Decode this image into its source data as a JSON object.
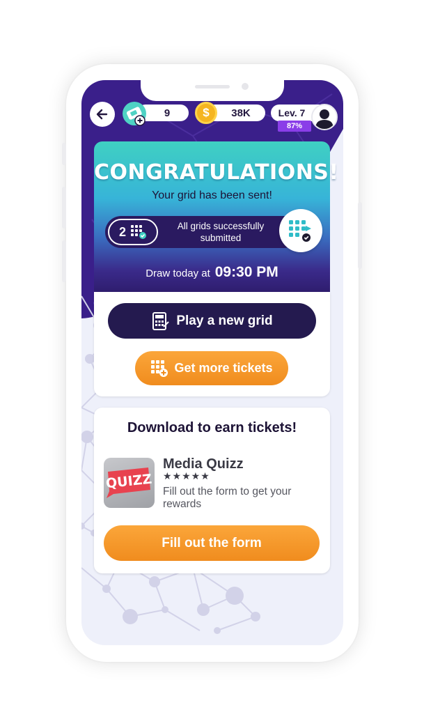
{
  "top_bar": {
    "tickets_count": "9",
    "coins": "38K",
    "level": "Lev. 7",
    "level_progress": "87%",
    "level_progress_fraction": 0.87
  },
  "congrats_card": {
    "title": "CONGRATULATIONS!",
    "subtitle": "Your grid has been sent!",
    "grid_count": "2",
    "status_text": "All grids successfully submitted",
    "draw_label": "Draw today at",
    "draw_time": "09:30 PM",
    "play_button": "Play a new grid",
    "tickets_button": "Get more tickets"
  },
  "download_card": {
    "title": "Download to earn tickets!",
    "app": {
      "icon_text": "QUIZZ",
      "name": "Media Quizz",
      "stars": "★★★★★",
      "description": "Fill out the form to get your rewards"
    },
    "form_button": "Fill out the form"
  },
  "colors": {
    "header_purple": "#3a1f8a",
    "accent_orange": "#f5961f",
    "dark_button": "#241a4f",
    "teal": "#3fd0c2"
  },
  "icons": {
    "back": "arrow-left-icon",
    "tickets": "ticket-plus-icon",
    "coins": "coin-icon",
    "avatar": "user-avatar-icon",
    "grid": "grid-check-icon",
    "submit": "grid-arrow-icon",
    "calculator": "calculator-icon",
    "grid_add": "grid-add-icon"
  }
}
